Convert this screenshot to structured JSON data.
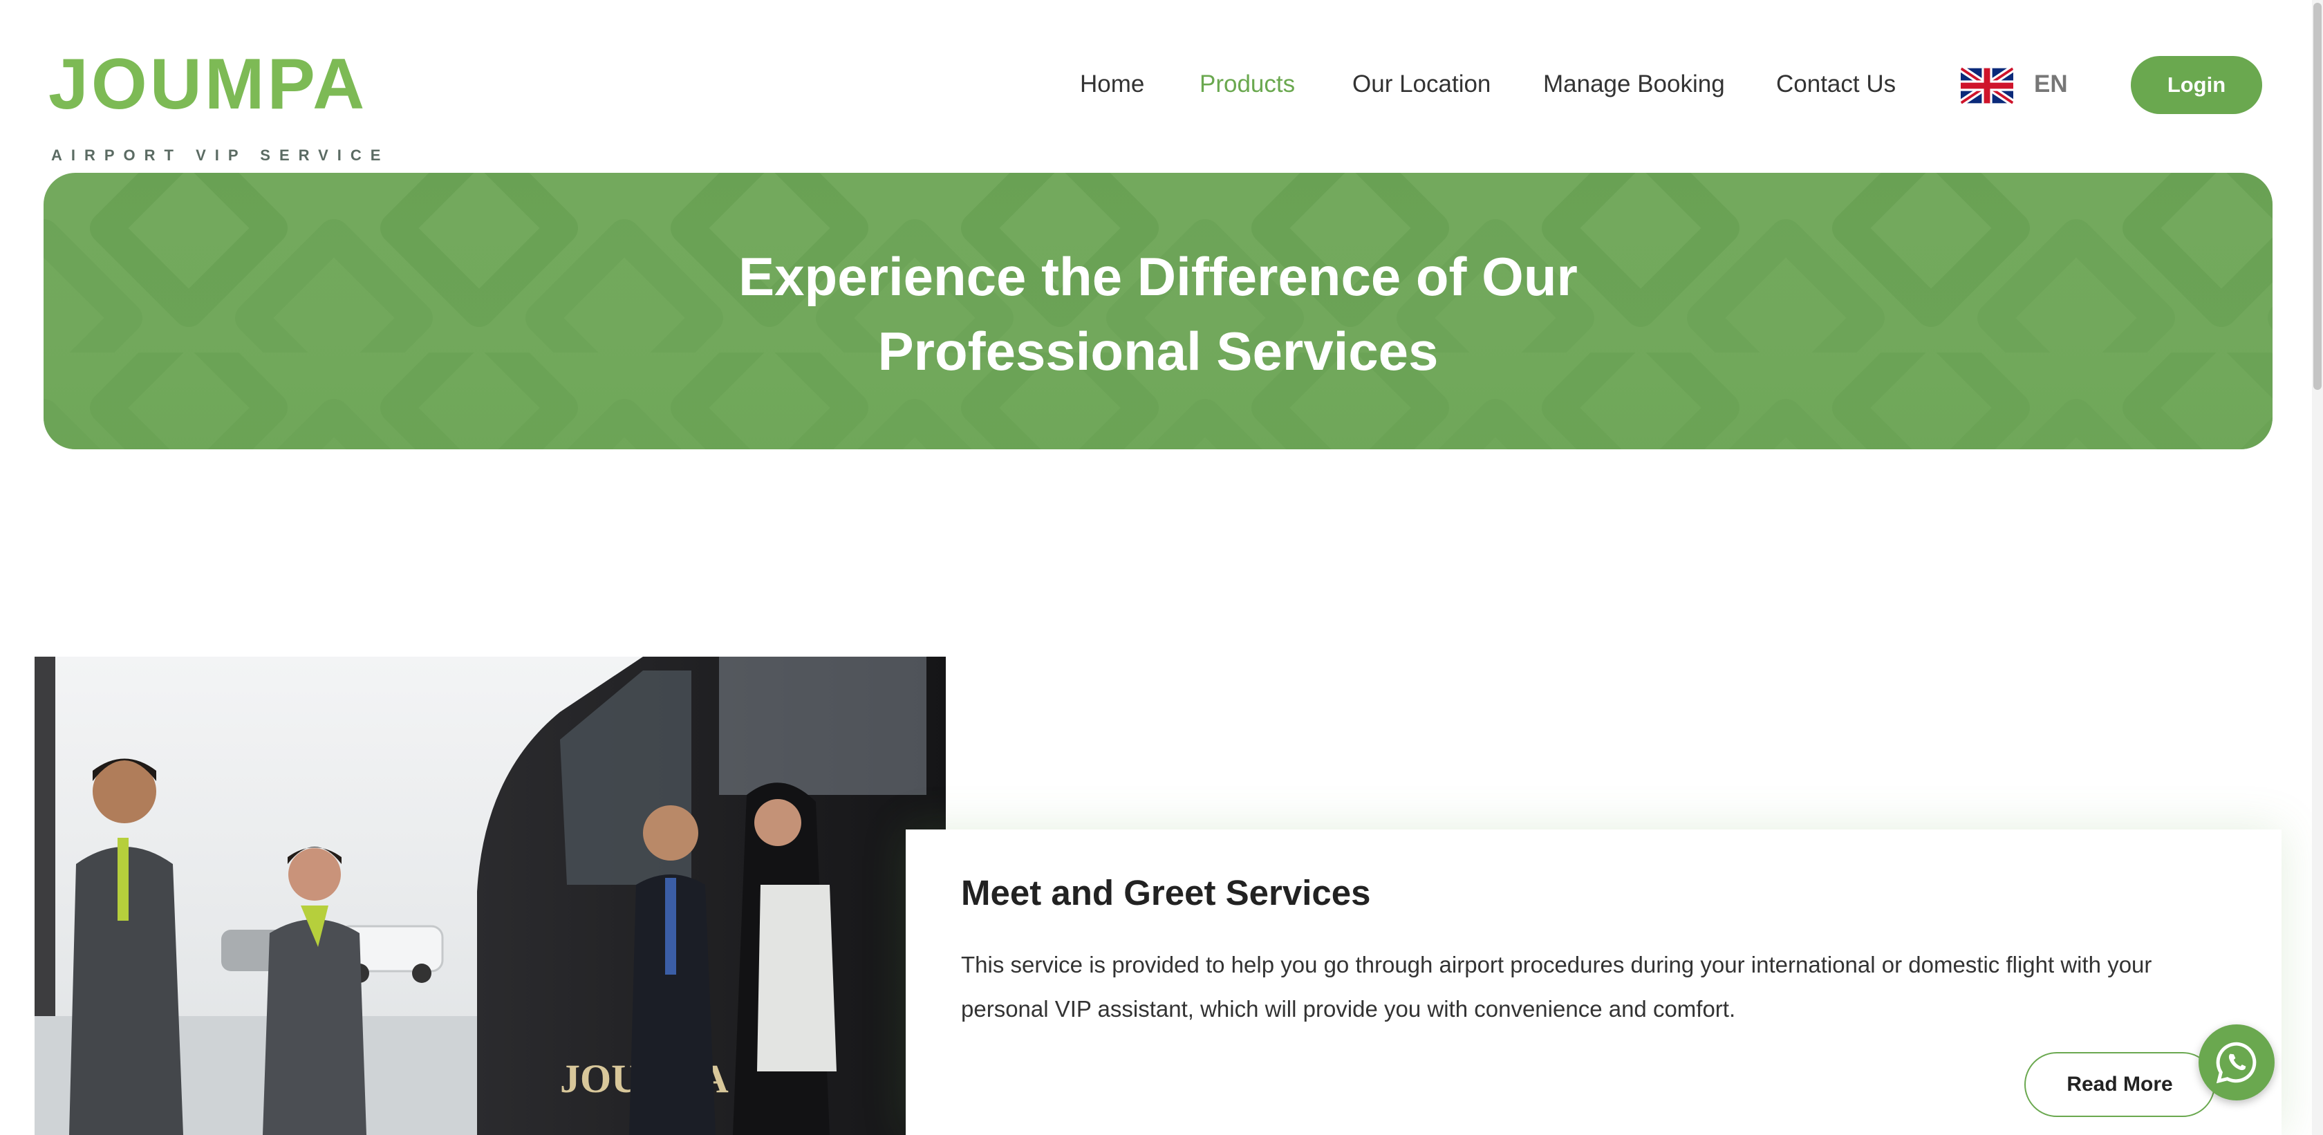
{
  "header": {
    "logo_word": "JOUMPA",
    "logo_tagline": "AIRPORT VIP SERVICE",
    "nav": [
      {
        "label": "Home",
        "active": false
      },
      {
        "label": "Products",
        "active": true
      },
      {
        "label": "Our Location",
        "active": false
      },
      {
        "label": "Manage Booking",
        "active": false
      },
      {
        "label": "Contact Us",
        "active": false
      }
    ],
    "language": "EN",
    "language_flag_icon": "uk-flag-icon",
    "login_label": "Login"
  },
  "hero": {
    "title_line1": "Experience the Difference of Our",
    "title_line2": "Professional Services"
  },
  "service": {
    "image_icon": "chauffeur-greeting-photo",
    "title": "Meet and Greet Services",
    "description": "This service is provided to help you go through airport procedures during your international or domestic flight with your personal VIP assistant, which will provide you with convenience and comfort.",
    "read_more_label": "Read More"
  },
  "floating": {
    "whatsapp_icon": "whatsapp-icon"
  },
  "colors": {
    "brand_green": "#6aa84f",
    "hero_green": "#73a95d",
    "text": "#333333"
  }
}
